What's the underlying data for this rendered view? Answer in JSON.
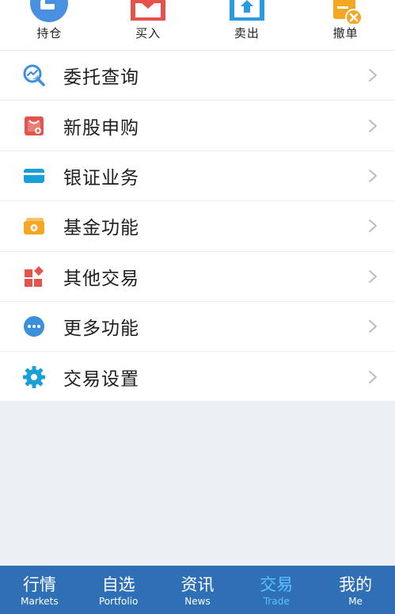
{
  "quick_actions": [
    {
      "label": "持仓",
      "icon": "holdings-icon",
      "color": "#4a90e2"
    },
    {
      "label": "买入",
      "icon": "buy-icon",
      "color": "#e5534b"
    },
    {
      "label": "卖出",
      "icon": "sell-icon",
      "color": "#2a9be0"
    },
    {
      "label": "撤单",
      "icon": "cancel-order-icon",
      "color": "#f5a623"
    }
  ],
  "menu": {
    "items": [
      {
        "label": "委托查询",
        "icon": "search-chart-icon",
        "color": "#3b8fdc"
      },
      {
        "label": "新股申购",
        "icon": "ipo-bag-icon",
        "color": "#e5534b"
      },
      {
        "label": "银证业务",
        "icon": "bank-card-icon",
        "color": "#1a9fd9"
      },
      {
        "label": "基金功能",
        "icon": "fund-money-icon",
        "color": "#f5a623"
      },
      {
        "label": "其他交易",
        "icon": "apps-grid-icon",
        "color": "#e5534b"
      },
      {
        "label": "更多功能",
        "icon": "more-dots-icon",
        "color": "#3b8fdc"
      },
      {
        "label": "交易设置",
        "icon": "gear-icon",
        "color": "#1a9fd9"
      }
    ]
  },
  "tabbar": {
    "background": "#2f6fb6",
    "active_color": "#5cc2ff",
    "tabs": [
      {
        "cn": "行情",
        "en": "Markets"
      },
      {
        "cn": "自选",
        "en": "Portfolio"
      },
      {
        "cn": "资讯",
        "en": "News"
      },
      {
        "cn": "交易",
        "en": "Trade",
        "active": true
      },
      {
        "cn": "我的",
        "en": "Me"
      }
    ]
  }
}
